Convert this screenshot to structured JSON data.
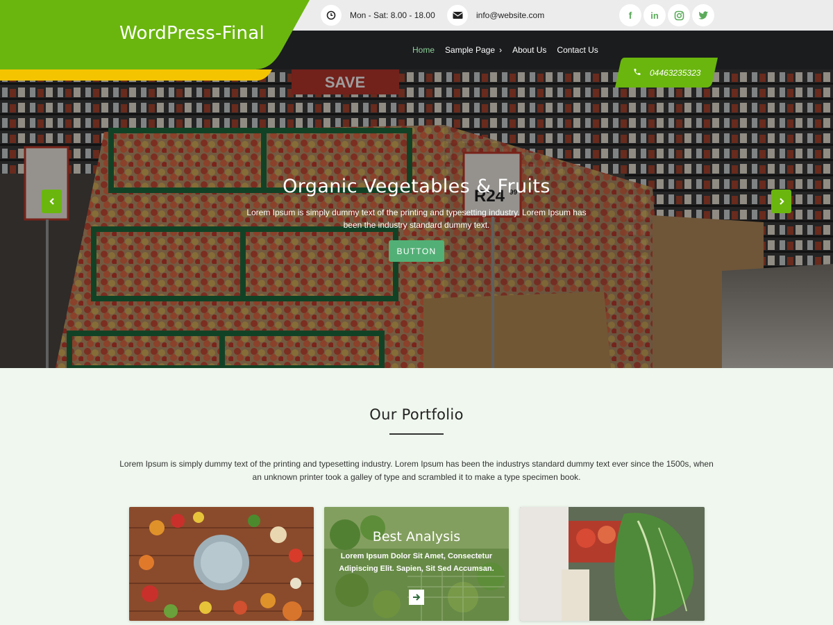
{
  "site": {
    "title": "WordPress-Final"
  },
  "topbar": {
    "hours": "Mon - Sat: 8.00 - 18.00",
    "email": "info@website.com",
    "social": [
      {
        "name": "facebook-icon",
        "glyph": "f"
      },
      {
        "name": "linkedin-icon",
        "glyph": "in"
      },
      {
        "name": "instagram-icon",
        "glyph": "◎"
      },
      {
        "name": "twitter-icon",
        "glyph": "🐦"
      }
    ]
  },
  "nav": {
    "items": [
      {
        "label": "Home",
        "active": true
      },
      {
        "label": "Sample Page",
        "active": false
      },
      {
        "label": "About Us",
        "active": false
      },
      {
        "label": "Contact Us",
        "active": false
      }
    ]
  },
  "phone": {
    "number": "04463235323"
  },
  "hero": {
    "title": "Organic Vegetables & Fruits",
    "text": "Lorem Ipsum is simply dummy text of the printing and typesetting industry. Lorem Ipsum has been the industry standard dummy text.",
    "button": "BUTTON",
    "sign_save": "SAVE",
    "sign_price": "R24",
    "sign_cents": "99"
  },
  "portfolio": {
    "title": "Our Portfolio",
    "text": "Lorem Ipsum is simply dummy text of the printing and typesetting industry. Lorem Ipsum has been the industrys standard dummy text ever since the 1500s, when an unknown printer took a galley of type and scrambled it to make a type specimen book.",
    "cards": [
      {
        "title": "",
        "text": ""
      },
      {
        "title": "Best Analysis",
        "text": "Lorem Ipsum Dolor Sit Amet, Consectetur Adipiscing Elit. Sapien, Sit Sed Accumsan."
      },
      {
        "title": "",
        "text": ""
      }
    ]
  },
  "colors": {
    "brand_green": "#6ab60e",
    "accent_yellow": "#f5c400",
    "nav_bg": "#1b1c1e",
    "button_green": "#52b076"
  }
}
